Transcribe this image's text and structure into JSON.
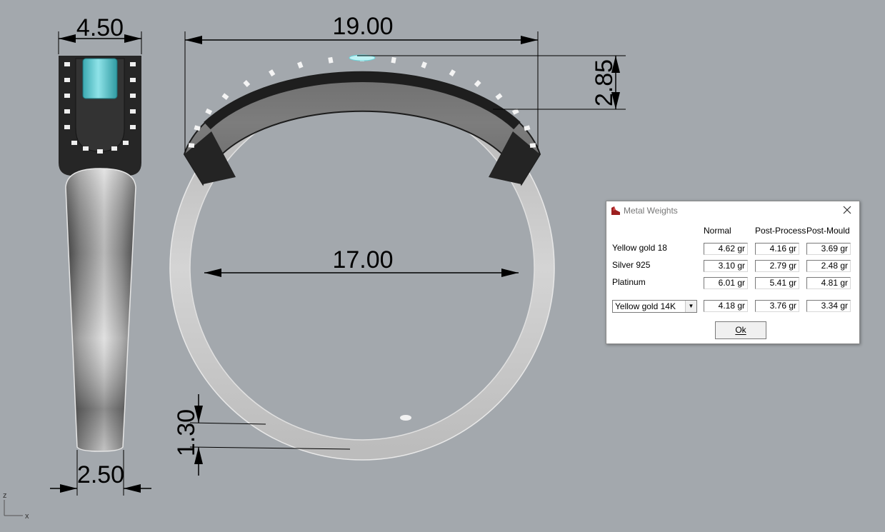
{
  "drawing": {
    "dimensions": {
      "top_width": "4.50",
      "overall_width": "19.00",
      "height": "2.85",
      "inner_diameter": "17.00",
      "band_thickness": "1.30",
      "bottom_width": "2.50"
    },
    "axis_labels": {
      "z": "z",
      "x": "x"
    }
  },
  "dialog": {
    "title": "Metal Weights",
    "icon": "rhino-app-icon",
    "columns": [
      "Normal",
      "Post-Process",
      "Post-Mould"
    ],
    "rows": [
      {
        "label": "Yellow gold 18",
        "values": [
          "4.62 gr",
          "4.16 gr",
          "3.69 gr"
        ]
      },
      {
        "label": "Silver 925",
        "values": [
          "3.10 gr",
          "2.79 gr",
          "2.48 gr"
        ]
      },
      {
        "label": "Platinum",
        "values": [
          "6.01 gr",
          "5.41 gr",
          "4.81 gr"
        ]
      }
    ],
    "custom_row": {
      "selected_metal": "Yellow gold 14K",
      "values": [
        "4.18 gr",
        "3.76 gr",
        "3.34 gr"
      ]
    },
    "ok_label": "Ok"
  },
  "colors": {
    "background": "#a3a8ad",
    "metal_dark": "#2a2a2a",
    "metal_light": "#c8c8c8",
    "gemstone": "#5bc6cc",
    "dialog_title_gray": "#777777"
  }
}
